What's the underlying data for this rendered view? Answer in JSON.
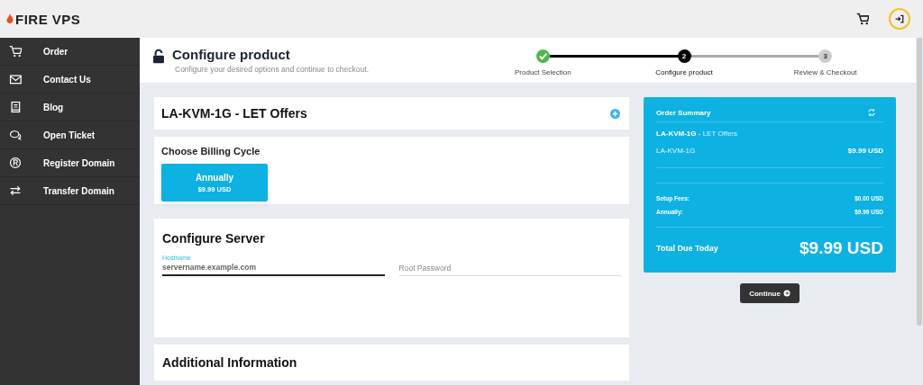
{
  "logo": {
    "text": "FIRE VPS"
  },
  "sidebar": {
    "items": [
      {
        "label": "Order"
      },
      {
        "label": "Contact Us"
      },
      {
        "label": "Blog"
      },
      {
        "label": "Open Ticket"
      },
      {
        "label": "Register Domain"
      },
      {
        "label": "Transfer Domain"
      }
    ]
  },
  "header": {
    "title": "Configure product",
    "subtitle": "Configure your desired options and continue to checkout."
  },
  "steps": [
    {
      "label": "Product Selection",
      "completed": true,
      "selected": false
    },
    {
      "number": "2",
      "label": "Configure product",
      "completed": false,
      "selected": true
    },
    {
      "number": "3",
      "label": "Review & Checkout",
      "completed": false,
      "selected": false
    }
  ],
  "product": {
    "title": "LA-KVM-1G - LET Offers"
  },
  "billing": {
    "heading": "Choose Billing Cycle",
    "options": [
      {
        "label": "Annually",
        "price": "$9.99 USD",
        "selected": true
      }
    ]
  },
  "server": {
    "heading": "Configure Server",
    "fields": [
      {
        "label": "Hostname",
        "placeholder": "servername.example.com",
        "focused": true
      },
      {
        "placeholder": "Root Password",
        "focused": false
      }
    ]
  },
  "additional": {
    "heading": "Additional Information"
  },
  "summary": {
    "title": "Order Summary",
    "product_name": "LA-KVM-1G",
    "separator": "-",
    "product_group": "LET Offers",
    "lines": [
      {
        "label": "LA-KVM-1G",
        "value": "$9.99 USD"
      }
    ],
    "fees": [
      {
        "label": "Setup Fees:",
        "value": "$0.00 USD"
      },
      {
        "label": "Annually:",
        "value": "$9.99 USD"
      }
    ],
    "total_label": "Total Due Today",
    "total": "$9.99 USD"
  },
  "continue_button": "Continue"
}
